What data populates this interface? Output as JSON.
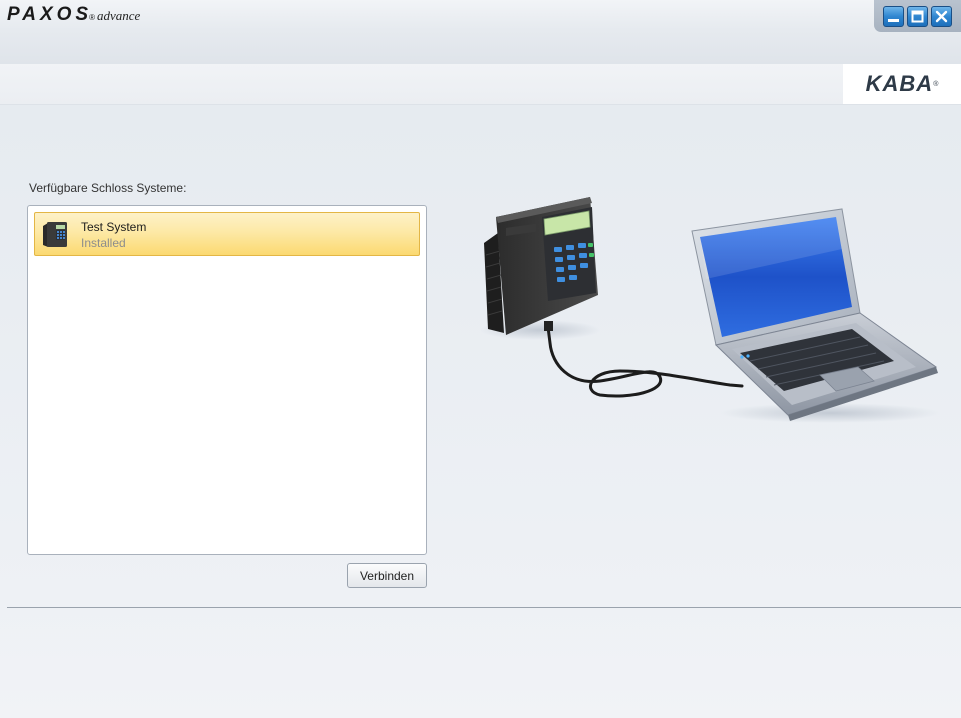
{
  "app": {
    "brand": "PAXOS",
    "reg_mark": "®",
    "edition": "advance"
  },
  "window_controls": {
    "minimize_icon": "minimize-icon",
    "maximize_icon": "maximize-icon",
    "close_icon": "close-icon"
  },
  "vendor_logo": {
    "text": "KABA",
    "reg_mark": "®"
  },
  "systems": {
    "label": "Verfügbare Schloss Systeme:",
    "items": [
      {
        "name": "Test System",
        "status": "Installed",
        "icon": "lock-terminal-icon",
        "selected": true
      }
    ],
    "connect_label": "Verbinden"
  },
  "illustration": {
    "icon": "lock-terminal-to-laptop-connection-illustration"
  },
  "colors": {
    "selection_fill": "#fde9a6",
    "selection_border": "#e3b645",
    "window_button": "#2f86d0"
  }
}
